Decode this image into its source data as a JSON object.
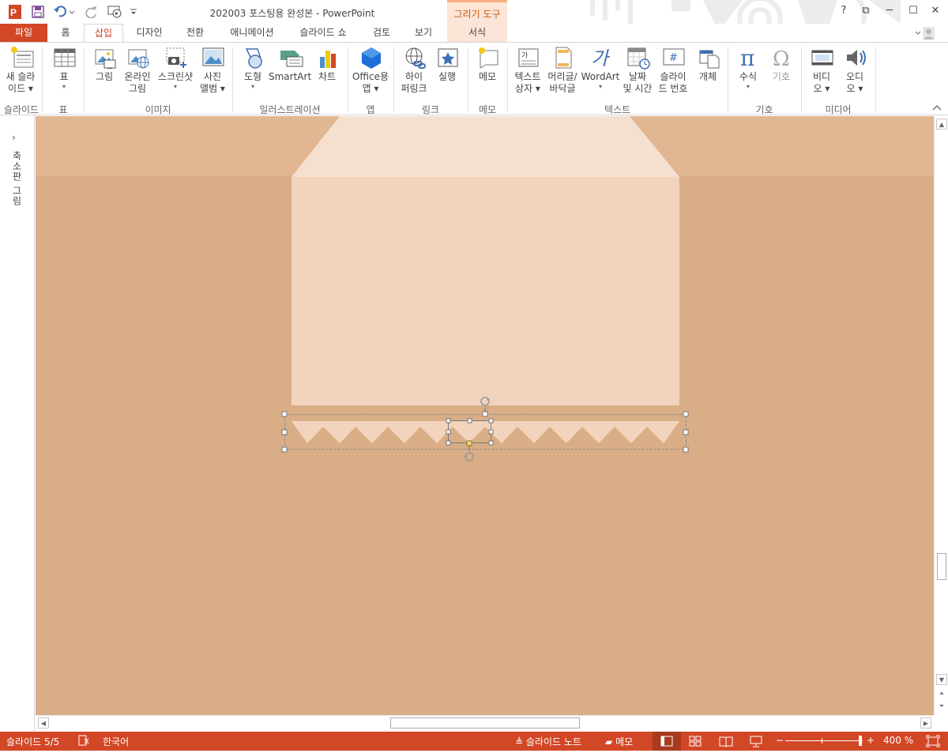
{
  "titlebar": {
    "document_title": "202003 포스팅용 완성본 - PowerPoint",
    "tool_context_header": "그리기 도구",
    "help": "?",
    "restore": "⧉",
    "minimize": "─",
    "maximize": "☐",
    "close": "✕"
  },
  "tabs": [
    {
      "label": "파일"
    },
    {
      "label": "홈"
    },
    {
      "label": "삽입"
    },
    {
      "label": "디자인"
    },
    {
      "label": "전환"
    },
    {
      "label": "애니메이션"
    },
    {
      "label": "슬라이드 쇼"
    },
    {
      "label": "검토"
    },
    {
      "label": "보기"
    },
    {
      "label": "서식"
    }
  ],
  "ribbon": {
    "buttons": [
      {
        "line1": "새 슬라",
        "line2": "이드 ▾",
        "icon": "new-slide-icon"
      },
      {
        "line1": "표",
        "line2": "▾",
        "icon": "table-icon"
      },
      {
        "line1": "그림",
        "line2": "",
        "icon": "picture-icon"
      },
      {
        "line1": "온라인",
        "line2": "그림",
        "icon": "online-picture-icon"
      },
      {
        "line1": "스크린샷",
        "line2": "▾",
        "icon": "screenshot-icon"
      },
      {
        "line1": "사진",
        "line2": "앨범 ▾",
        "icon": "photo-album-icon"
      },
      {
        "line1": "도형",
        "line2": "▾",
        "icon": "shapes-icon"
      },
      {
        "line1": "SmartArt",
        "line2": "",
        "icon": "smartart-icon"
      },
      {
        "line1": "차트",
        "line2": "",
        "icon": "chart-icon"
      },
      {
        "line1": "Office용",
        "line2": "앱 ▾",
        "icon": "office-apps-icon"
      },
      {
        "line1": "하이",
        "line2": "퍼링크",
        "icon": "hyperlink-icon"
      },
      {
        "line1": "실행",
        "line2": "",
        "icon": "action-icon"
      },
      {
        "line1": "메모",
        "line2": "",
        "icon": "comment-icon"
      },
      {
        "line1": "텍스트",
        "line2": "상자 ▾",
        "icon": "text-box-icon"
      },
      {
        "line1": "머리글/",
        "line2": "바닥글",
        "icon": "header-footer-icon"
      },
      {
        "line1": "WordArt",
        "line2": "▾",
        "icon": "wordart-icon"
      },
      {
        "line1": "날짜",
        "line2": "및 시간",
        "icon": "date-time-icon"
      },
      {
        "line1": "슬라이",
        "line2": "드 번호",
        "icon": "slide-number-icon"
      },
      {
        "line1": "개체",
        "line2": "",
        "icon": "object-icon"
      },
      {
        "line1": "수식",
        "line2": "▾",
        "icon": "equation-icon"
      },
      {
        "line1": "기호",
        "line2": "",
        "icon": "symbol-icon"
      },
      {
        "line1": "비디",
        "line2": "오 ▾",
        "icon": "video-icon"
      },
      {
        "line1": "오디",
        "line2": "오 ▾",
        "icon": "audio-icon"
      }
    ],
    "groups": [
      {
        "label": "슬라이드"
      },
      {
        "label": "표"
      },
      {
        "label": "이미지"
      },
      {
        "label": "일러스트레이션"
      },
      {
        "label": "앱"
      },
      {
        "label": "링크"
      },
      {
        "label": "메모"
      },
      {
        "label": "텍스트"
      },
      {
        "label": "기호"
      },
      {
        "label": "미디어"
      }
    ]
  },
  "leftpane": {
    "collapsed_label": "축소판 그림",
    "expand": "›"
  },
  "statusbar": {
    "slide_counter": "슬라이드 5/5",
    "language": "한국어",
    "notes": "슬라이드 노트",
    "comments": "메모",
    "zoom": "400 %",
    "zoom_minus": "−",
    "zoom_plus": "+"
  },
  "colors": {
    "accent": "#d24726",
    "slide_background": "#d9ae87",
    "slide_band": "#e0b792",
    "card_light": "#f5e0d0",
    "card_main": "#f2d4bd"
  }
}
